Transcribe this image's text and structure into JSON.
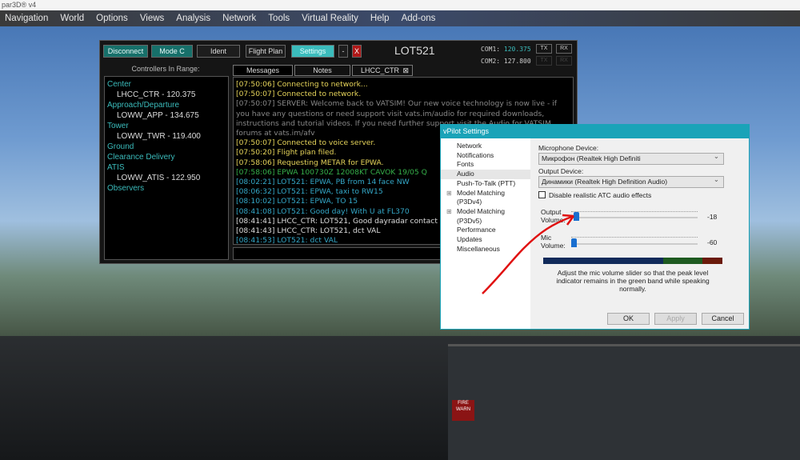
{
  "app_title": "par3D® v4",
  "menu": [
    "Navigation",
    "World",
    "Options",
    "Views",
    "Analysis",
    "Network",
    "Tools",
    "Virtual Reality",
    "Help",
    "Add-ons"
  ],
  "vpilot": {
    "buttons": {
      "disconnect": "Disconnect",
      "mode_c": "Mode C",
      "ident": "Ident",
      "flight_plan": "Flight Plan",
      "settings": "Settings",
      "minimize": "-",
      "close": "X"
    },
    "callsign": "LOT521",
    "com1": {
      "label": "COM1:",
      "freq": "120.375"
    },
    "com2": {
      "label": "COM2:",
      "freq": "127.800"
    },
    "tx": "TX",
    "rx": "RX",
    "controllers_header": "Controllers In Range:",
    "controllers": [
      {
        "cat": "Center",
        "ent": "LHCC_CTR - 120.375"
      },
      {
        "cat": "Approach/Departure",
        "ent": "LOWW_APP - 134.675"
      },
      {
        "cat": "Tower",
        "ent": "LOWW_TWR - 119.400"
      },
      {
        "cat": "Ground",
        "ent": ""
      },
      {
        "cat": "Clearance Delivery",
        "ent": ""
      },
      {
        "cat": "ATIS",
        "ent": "LOWW_ATIS - 122.950"
      },
      {
        "cat": "Observers",
        "ent": ""
      }
    ],
    "tabs": [
      "Messages",
      "Notes",
      "LHCC_CTR"
    ],
    "messages": [
      {
        "t": "[07:50:06] Connecting to network...",
        "c": "y"
      },
      {
        "t": "[07:50:07] Connected to network.",
        "c": "y"
      },
      {
        "t": "[07:50:07] SERVER: Welcome back to VATSIM! Our new voice technology is now live - if you have any questions or need support visit vats.im/audio for required downloads, instructions and tutorial videos. If you need further support visit the Audio for VATSIM forums at vats.im/afv",
        "c": "g"
      },
      {
        "t": "[07:50:07] Connected to voice server.",
        "c": "y"
      },
      {
        "t": "[07:50:20] Flight plan filed.",
        "c": "y"
      },
      {
        "t": "[07:58:06] Requesting METAR for EPWA.",
        "c": "y"
      },
      {
        "t": "[07:58:06] EPWA 100730Z 12008KT CAVOK 19/05 Q",
        "c": "gr"
      },
      {
        "t": "[08:02:21] LOT521: EPWA, PB from 14 face NW",
        "c": "c"
      },
      {
        "t": "[08:06:32] LOT521: EPWA, taxi to RW15",
        "c": "c"
      },
      {
        "t": "[08:10:02] LOT521: EPWA, TO 15",
        "c": "c"
      },
      {
        "t": "[08:41:08] LOT521: Good day! With U at FL370",
        "c": "c"
      },
      {
        "t": "[08:41:41] LHCC_CTR: LOT521, Good dayradar contact",
        "c": "w"
      },
      {
        "t": "[08:41:43] LHCC_CTR: LOT521, dct VAL",
        "c": "w"
      },
      {
        "t": "[08:41:53] LOT521: dct VAL",
        "c": "c"
      }
    ]
  },
  "settings": {
    "title": "vPilot Settings",
    "nav": [
      "Network",
      "Notifications",
      "Fonts",
      "Audio",
      "Push-To-Talk (PTT)",
      "Model Matching (P3Dv4)",
      "Model Matching (P3Dv5)",
      "Performance",
      "Updates",
      "Miscellaneous"
    ],
    "mic_label": "Microphone Device:",
    "mic_value": "Микрофон (Realtek High Definiti",
    "out_label": "Output Device:",
    "out_value": "Динамики (Realtek High Definition Audio)",
    "checkbox_label": "Disable realistic ATC audio effects",
    "output_volume_label": "Output Volume:",
    "output_volume": "-18",
    "mic_volume_label": "Mic Volume:",
    "mic_volume": "-60",
    "hint": "Adjust the mic volume slider so that the peak level indicator remains in the green band while speaking normally.",
    "ok": "OK",
    "apply": "Apply",
    "cancel": "Cancel"
  },
  "colors": {
    "teal": "#3bbcbc",
    "dialog_accent": "#1aa3b8"
  }
}
